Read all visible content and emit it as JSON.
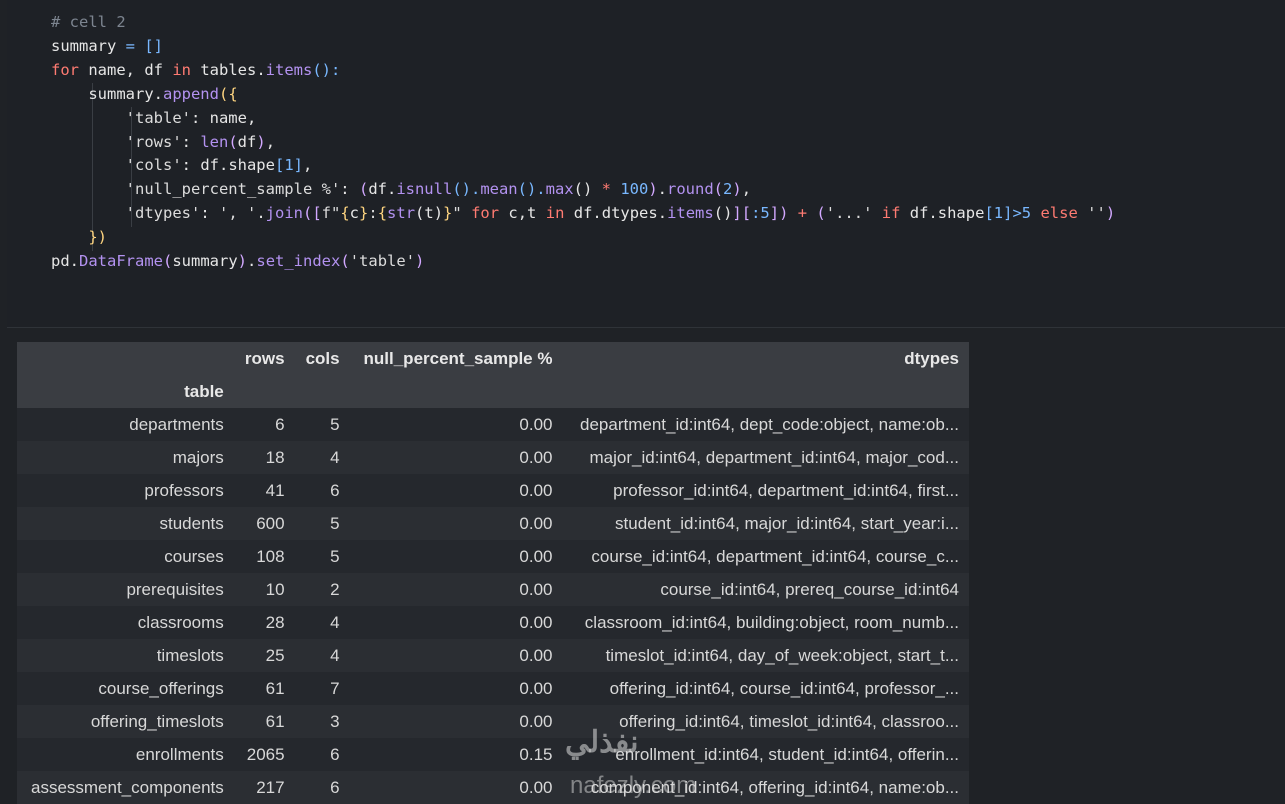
{
  "code_cell": {
    "lines": [
      [
        [
          "# cell 2",
          "t-com"
        ]
      ],
      [
        [
          "summary ",
          ""
        ],
        [
          "=",
          "t-op"
        ],
        [
          " ",
          ""
        ],
        [
          "[]",
          "t-op"
        ]
      ],
      [
        [
          "for",
          "t-kw"
        ],
        [
          " name, df ",
          ""
        ],
        [
          "in",
          "t-kw"
        ],
        [
          " tables.",
          ""
        ],
        [
          "items",
          "t-fn"
        ],
        [
          "():",
          "t-op"
        ]
      ],
      [
        [
          "    summary.",
          ""
        ],
        [
          "append",
          "t-fn"
        ],
        [
          "({",
          "t-br"
        ]
      ],
      [
        [
          "        ",
          ""
        ],
        [
          "'table'",
          "t-str"
        ],
        [
          ": name,",
          ""
        ]
      ],
      [
        [
          "        ",
          ""
        ],
        [
          "'rows'",
          "t-str"
        ],
        [
          ": ",
          ""
        ],
        [
          "len",
          "t-fn"
        ],
        [
          "(",
          "t-p"
        ],
        [
          "df",
          ""
        ],
        [
          ")",
          "t-p"
        ],
        [
          ",",
          ""
        ]
      ],
      [
        [
          "        ",
          ""
        ],
        [
          "'cols'",
          "t-str"
        ],
        [
          ": df.shape",
          ""
        ],
        [
          "[",
          "t-op"
        ],
        [
          "1",
          "t-num"
        ],
        [
          "]",
          "t-op"
        ],
        [
          ",",
          ""
        ]
      ],
      [
        [
          "        ",
          ""
        ],
        [
          "'null_percent_sample %'",
          "t-str"
        ],
        [
          ": ",
          ""
        ],
        [
          "(",
          "t-p"
        ],
        [
          "df.",
          ""
        ],
        [
          "isnull",
          "t-fn"
        ],
        [
          "().",
          "t-op"
        ],
        [
          "mean",
          "t-fn"
        ],
        [
          "().",
          "t-op"
        ],
        [
          "max",
          "t-fn"
        ],
        [
          "()",
          ""
        ],
        [
          " * ",
          "t-kw"
        ],
        [
          "100",
          "t-num"
        ],
        [
          ")",
          "t-p"
        ],
        [
          ".",
          ""
        ],
        [
          "round",
          "t-fn"
        ],
        [
          "(",
          "t-p"
        ],
        [
          "2",
          "t-num"
        ],
        [
          ")",
          "t-p"
        ],
        [
          ",",
          ""
        ]
      ],
      [
        [
          "        ",
          ""
        ],
        [
          "'dtypes'",
          "t-str"
        ],
        [
          ": ",
          ""
        ],
        [
          "', '",
          "t-str"
        ],
        [
          ".",
          ""
        ],
        [
          "join",
          "t-fn"
        ],
        [
          "([",
          "t-p"
        ],
        [
          "f\"",
          "t-str"
        ],
        [
          "{",
          "t-br"
        ],
        [
          "c",
          ""
        ],
        [
          "}",
          "t-br"
        ],
        [
          ":",
          "t-str"
        ],
        [
          "{",
          "t-br"
        ],
        [
          "str",
          "t-fn"
        ],
        [
          "(t)",
          ""
        ],
        [
          "}",
          "t-br"
        ],
        [
          "\"",
          "t-str"
        ],
        [
          " for",
          "t-kw"
        ],
        [
          " c,t ",
          ""
        ],
        [
          "in",
          "t-kw"
        ],
        [
          " df.dtypes.",
          ""
        ],
        [
          "items",
          "t-fn"
        ],
        [
          "()",
          ""
        ],
        [
          "][",
          "t-p"
        ],
        [
          ":5",
          "t-num"
        ],
        [
          "])",
          "t-p"
        ],
        [
          " + ",
          "t-kw"
        ],
        [
          "(",
          "t-p"
        ],
        [
          "'...'",
          "t-str"
        ],
        [
          " if",
          "t-kw"
        ],
        [
          " df.shape",
          ""
        ],
        [
          "[",
          "t-op"
        ],
        [
          "1",
          "t-num"
        ],
        [
          "]",
          "t-op"
        ],
        [
          ">5",
          "t-num"
        ],
        [
          " else",
          "t-kw"
        ],
        [
          " ''",
          "t-str"
        ],
        [
          ")",
          "t-p"
        ]
      ],
      [
        [
          "    ",
          ""
        ],
        [
          "})",
          "t-br"
        ]
      ],
      [
        [
          "pd.",
          ""
        ],
        [
          "DataFrame",
          "t-fn"
        ],
        [
          "(",
          "t-p"
        ],
        [
          "summary",
          ""
        ],
        [
          ")",
          "t-p"
        ],
        [
          ".",
          ""
        ],
        [
          "set_index",
          "t-fn"
        ],
        [
          "(",
          "t-p"
        ],
        [
          "'table'",
          "t-str"
        ],
        [
          ")",
          "t-p"
        ]
      ]
    ]
  },
  "output_table": {
    "columns": [
      "rows",
      "cols",
      "null_percent_sample %",
      "dtypes"
    ],
    "index_name": "table",
    "rows": [
      {
        "table": "departments",
        "rows": "6",
        "cols": "5",
        "null": "0.00",
        "dtypes": "department_id:int64, dept_code:object, name:ob..."
      },
      {
        "table": "majors",
        "rows": "18",
        "cols": "4",
        "null": "0.00",
        "dtypes": "major_id:int64, department_id:int64, major_cod..."
      },
      {
        "table": "professors",
        "rows": "41",
        "cols": "6",
        "null": "0.00",
        "dtypes": "professor_id:int64, department_id:int64, first..."
      },
      {
        "table": "students",
        "rows": "600",
        "cols": "5",
        "null": "0.00",
        "dtypes": "student_id:int64, major_id:int64, start_year:i..."
      },
      {
        "table": "courses",
        "rows": "108",
        "cols": "5",
        "null": "0.00",
        "dtypes": "course_id:int64, department_id:int64, course_c..."
      },
      {
        "table": "prerequisites",
        "rows": "10",
        "cols": "2",
        "null": "0.00",
        "dtypes": "course_id:int64, prereq_course_id:int64"
      },
      {
        "table": "classrooms",
        "rows": "28",
        "cols": "4",
        "null": "0.00",
        "dtypes": "classroom_id:int64, building:object, room_numb..."
      },
      {
        "table": "timeslots",
        "rows": "25",
        "cols": "4",
        "null": "0.00",
        "dtypes": "timeslot_id:int64, day_of_week:object, start_t..."
      },
      {
        "table": "course_offerings",
        "rows": "61",
        "cols": "7",
        "null": "0.00",
        "dtypes": "offering_id:int64, course_id:int64, professor_..."
      },
      {
        "table": "offering_timeslots",
        "rows": "61",
        "cols": "3",
        "null": "0.00",
        "dtypes": "offering_id:int64, timeslot_id:int64, classroo..."
      },
      {
        "table": "enrollments",
        "rows": "2065",
        "cols": "6",
        "null": "0.15",
        "dtypes": "enrollment_id:int64, student_id:int64, offerin..."
      },
      {
        "table": "assessment_components",
        "rows": "217",
        "cols": "6",
        "null": "0.00",
        "dtypes": "component_id:int64, offering_id:int64, name:ob..."
      }
    ]
  },
  "watermark": {
    "arabic": "نفذلي",
    "latin": "nafezly.com"
  }
}
